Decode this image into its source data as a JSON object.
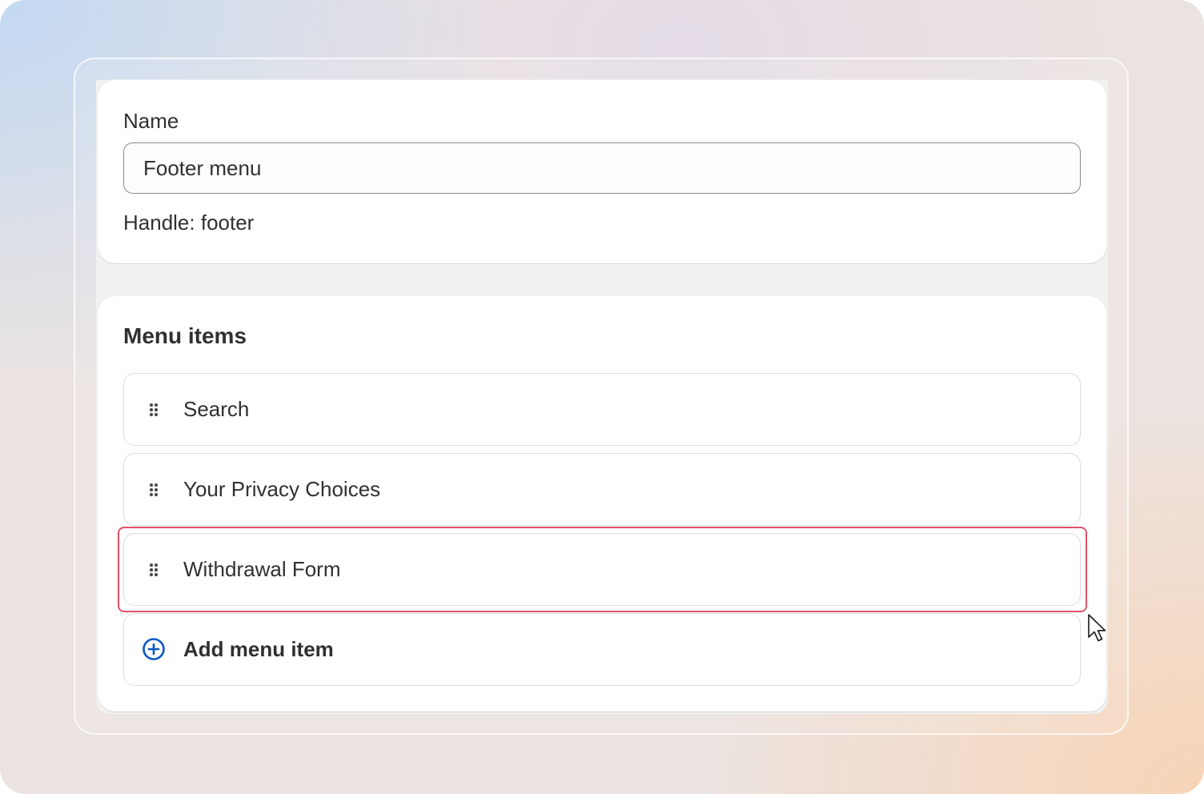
{
  "name_section": {
    "label": "Name",
    "value": "Footer menu",
    "handle": "Handle: footer"
  },
  "menu_section": {
    "title": "Menu items",
    "items": [
      {
        "label": "Search",
        "icon": "drag-handle-icon"
      },
      {
        "label": "Your Privacy Choices",
        "icon": "drag-handle-icon"
      },
      {
        "label": "Withdrawal Form",
        "icon": "drag-handle-icon",
        "highlighted": true
      }
    ],
    "add_label": "Add menu item",
    "add_icon": "plus-circle-icon"
  },
  "colors": {
    "accent": "#0b58c8",
    "highlight": "#e0516a",
    "text": "#303030"
  }
}
